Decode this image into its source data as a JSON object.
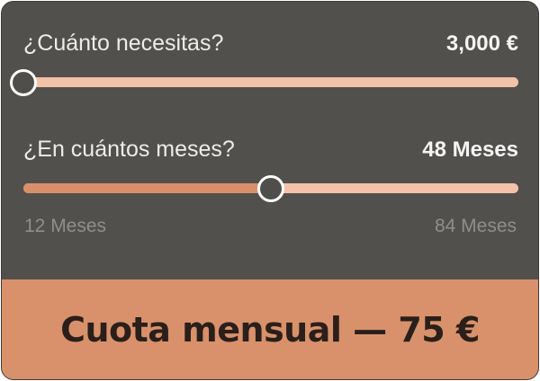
{
  "amount": {
    "label": "¿Cuánto necesitas?",
    "value_text": "3,000 €",
    "slider_fraction": 0.0
  },
  "months": {
    "label": "¿En cuántos meses?",
    "value_text": "48 Meses",
    "slider_fraction": 0.5,
    "min_label": "12 Meses",
    "max_label": "84 Meses"
  },
  "summary": {
    "text": "Cuota mensual — 75 €"
  },
  "colors": {
    "card_background": "#51504c",
    "track": "#f4c2a8",
    "track_fill": "#d98f6a",
    "footer": "#d9916b"
  }
}
